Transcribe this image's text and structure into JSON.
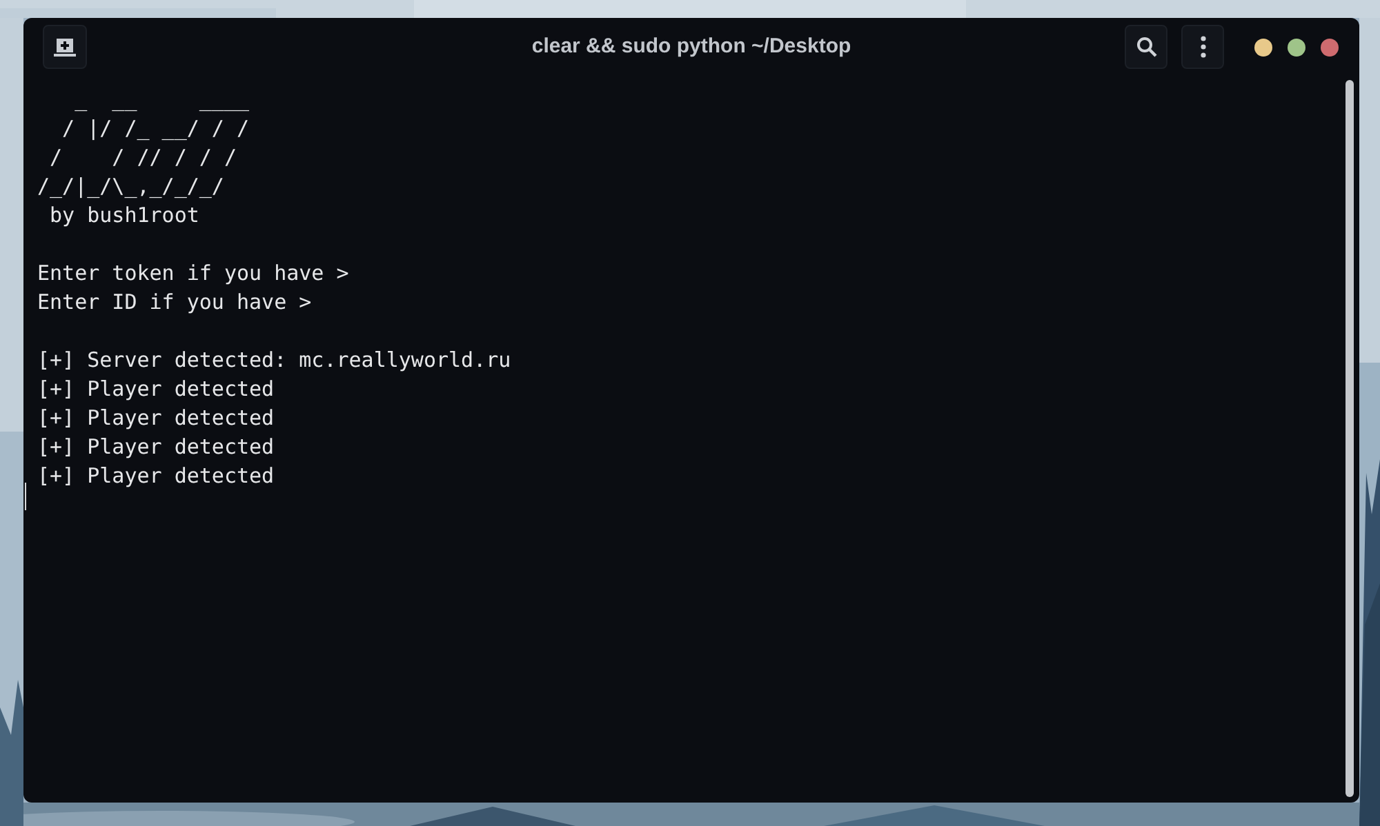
{
  "window": {
    "title": "clear && sudo python ~/Desktop"
  },
  "terminal": {
    "blocks": [
      {
        "lines": [
          "   _  __     ____",
          "  / |/ /_ __/ / /",
          " /    / // / / /",
          "/_/|_/\\_,_/_/_/",
          " by bush1root"
        ]
      },
      {
        "lines": [
          "Enter token if you have >",
          "Enter ID if you have >"
        ]
      },
      {
        "lines": [
          "[+] Server detected: mc.reallyworld.ru",
          "[+] Player detected",
          "[+] Player detected",
          "[+] Player detected",
          "[+] Player detected"
        ]
      }
    ]
  }
}
